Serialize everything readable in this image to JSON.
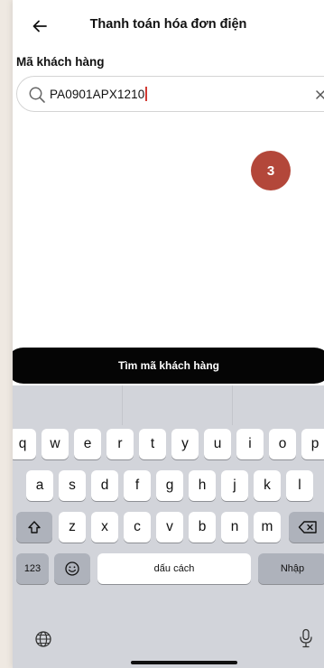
{
  "header": {
    "title": "Thanh toán hóa đơn điện",
    "back_icon": "arrow-left-icon"
  },
  "form": {
    "label": "Mã khách hàng",
    "search_value": "PA0901APX1210"
  },
  "badge": {
    "number": "3",
    "color": "#b3473a"
  },
  "action": {
    "find_label": "Tìm mã khách hàng"
  },
  "keyboard": {
    "row1": [
      "q",
      "w",
      "e",
      "r",
      "t",
      "y",
      "u",
      "i",
      "o",
      "p"
    ],
    "row2": [
      "a",
      "s",
      "d",
      "f",
      "g",
      "h",
      "j",
      "k",
      "l"
    ],
    "row3": [
      "z",
      "x",
      "c",
      "v",
      "b",
      "n",
      "m"
    ],
    "numbers_label": "123",
    "space_label": "dấu cách",
    "return_label": "Nhập"
  }
}
